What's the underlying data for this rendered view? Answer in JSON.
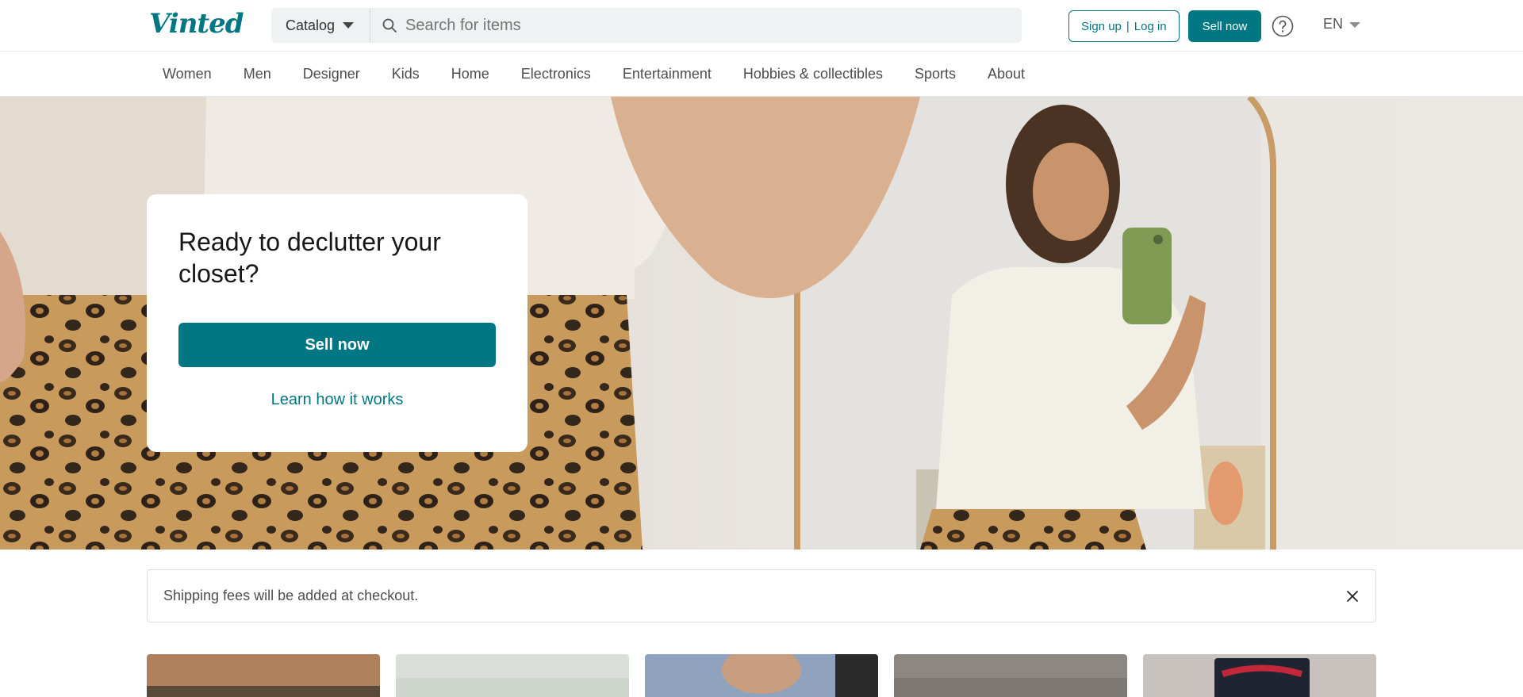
{
  "header": {
    "logo": "Vinted",
    "catalog_label": "Catalog",
    "search_placeholder": "Search for items",
    "signup_label": "Sign up",
    "auth_separator": "|",
    "login_label": "Log in",
    "sell_label": "Sell now",
    "help_icon": "question-circle-icon",
    "language": "EN"
  },
  "nav": {
    "items": [
      "Women",
      "Men",
      "Designer",
      "Kids",
      "Home",
      "Electronics",
      "Entertainment",
      "Hobbies & collectibles",
      "Sports",
      "About"
    ]
  },
  "hero": {
    "title": "Ready to declutter your closet?",
    "sell_label": "Sell now",
    "learn_label": "Learn how it works"
  },
  "notice": {
    "text": "Shipping fees will be added at checkout.",
    "close_icon": "close-icon"
  },
  "items": {
    "thumbnails": [
      "item-photo-1",
      "item-photo-2",
      "item-photo-3",
      "item-photo-4",
      "item-photo-5"
    ]
  },
  "colors": {
    "brand": "#007782",
    "search_bg": "#eef2f2",
    "text_muted": "#4d4d4d"
  }
}
